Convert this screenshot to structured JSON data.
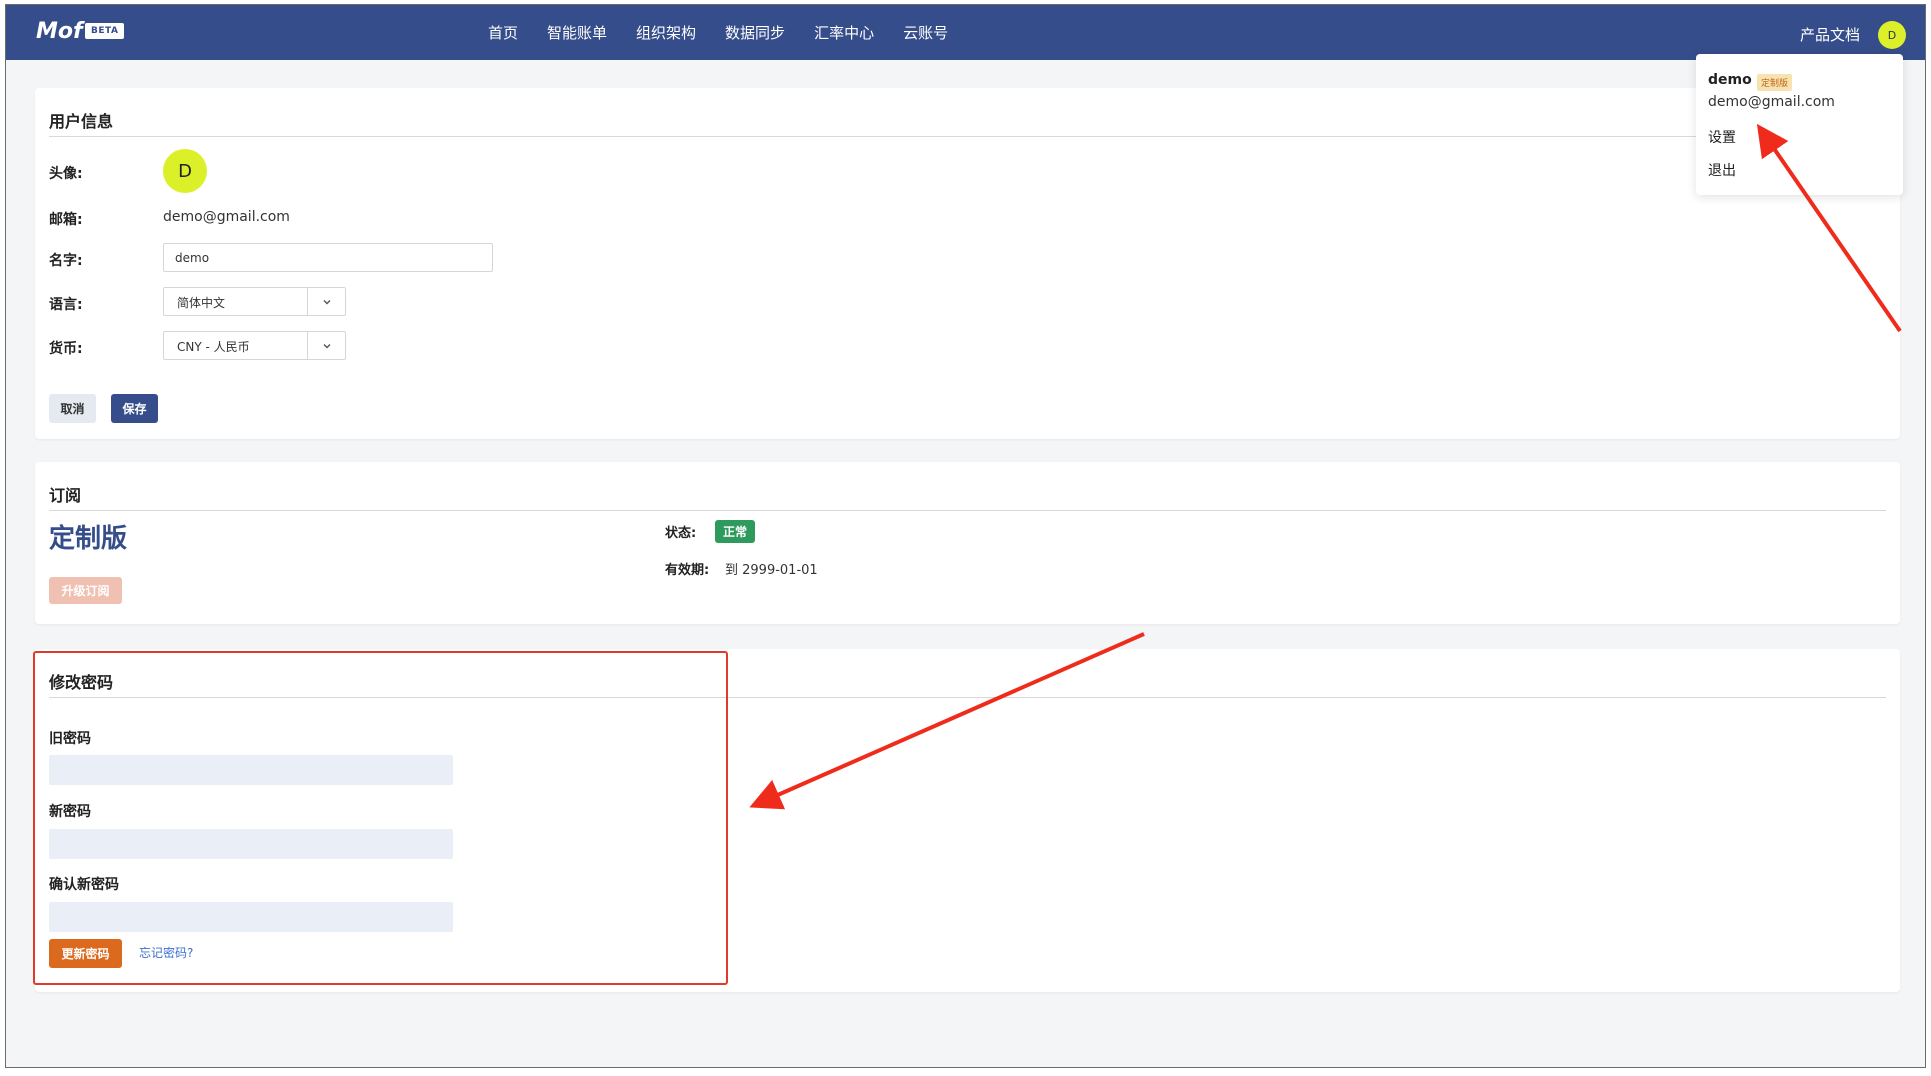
{
  "header": {
    "logo": "Mof",
    "beta_badge": "BETA",
    "nav": [
      "首页",
      "智能账单",
      "组织架构",
      "数据同步",
      "汇率中心",
      "云账号"
    ],
    "docs_link": "产品文档",
    "avatar_letter": "D"
  },
  "user_info": {
    "title": "用户信息",
    "avatar_label": "头像:",
    "avatar_letter": "D",
    "email_label": "邮箱:",
    "email_value": "demo@gmail.com",
    "name_label": "名字:",
    "name_value": "demo",
    "language_label": "语言:",
    "language_value": "简体中文",
    "currency_label": "货币:",
    "currency_value": "CNY - 人民币",
    "cancel_label": "取消",
    "save_label": "保存"
  },
  "subscription": {
    "title": "订阅",
    "plan_name": "定制版",
    "upgrade_label": "升级订阅",
    "status_label": "状态:",
    "status_value": "正常",
    "expire_label": "有效期:",
    "expire_value": "到 2999-01-01"
  },
  "change_password": {
    "title": "修改密码",
    "old_label": "旧密码",
    "new_label": "新密码",
    "confirm_label": "确认新密码",
    "update_label": "更新密码",
    "forgot_label": "忘记密码?"
  },
  "user_menu": {
    "username": "demo",
    "plan_badge": "定制版",
    "email": "demo@gmail.com",
    "settings": "设置",
    "logout": "退出"
  },
  "colors": {
    "nav_bg": "#354d8a",
    "avatar": "#dcf02a",
    "status_ok": "#2f9a5e",
    "update_button": "#dc6a1e",
    "annotation": "#e23a2a"
  }
}
